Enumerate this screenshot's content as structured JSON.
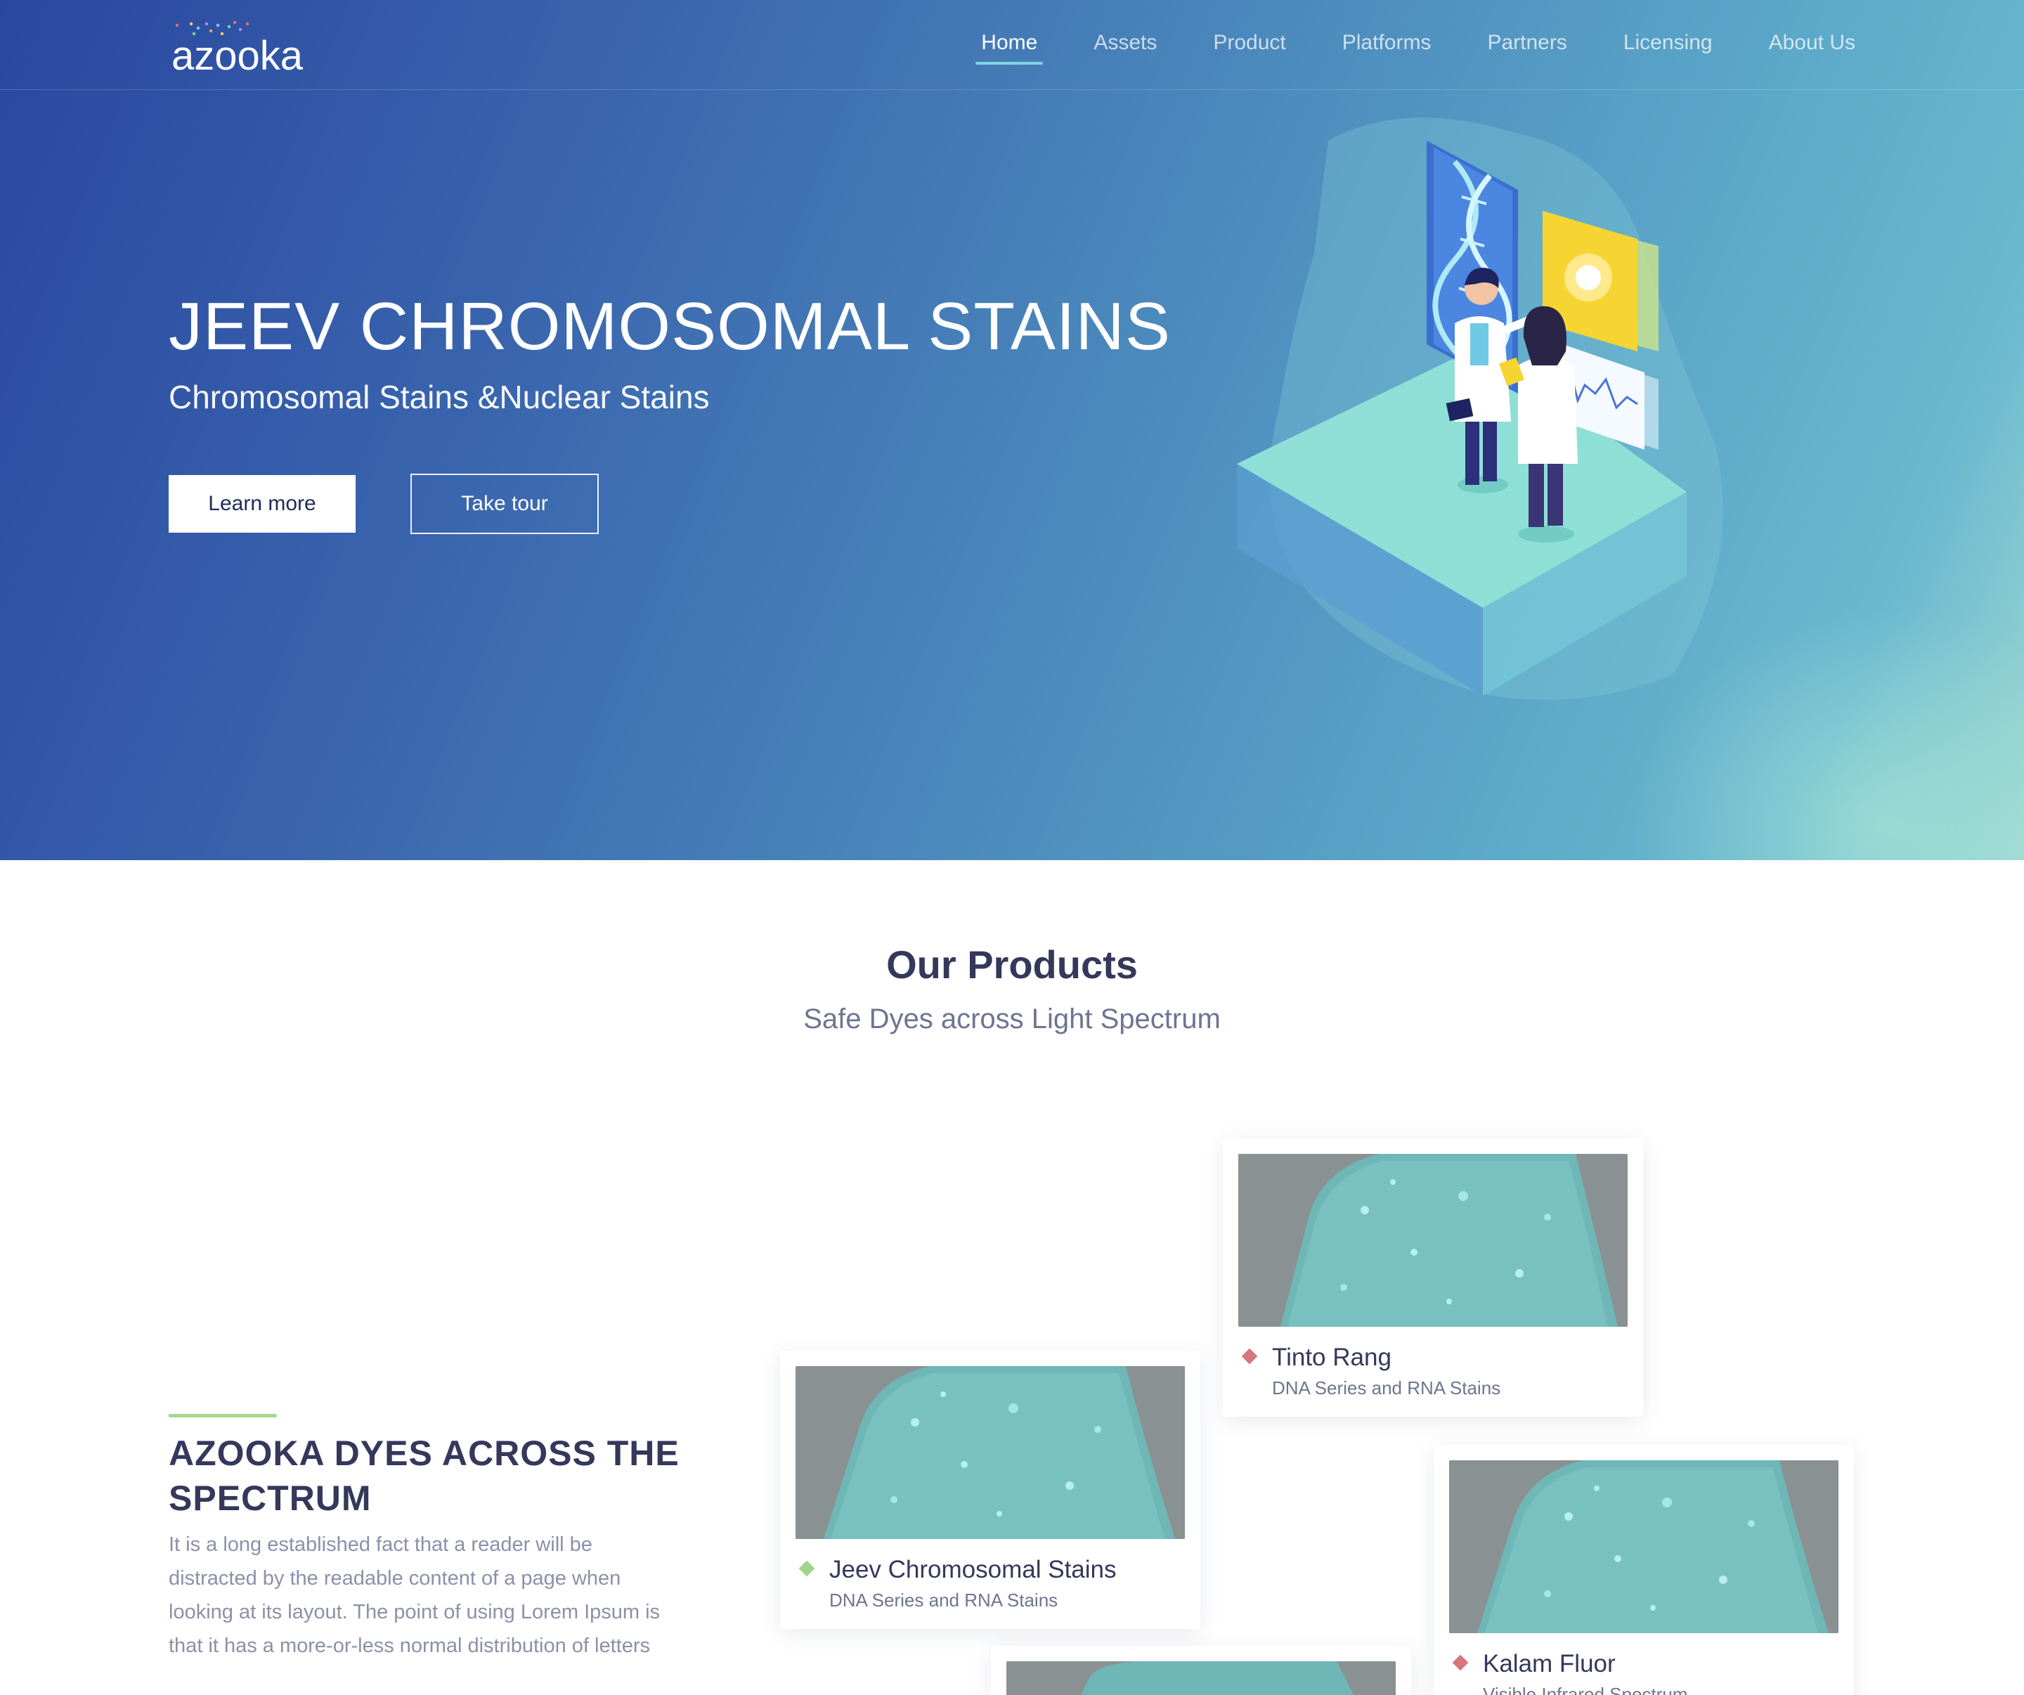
{
  "brand": {
    "logo_text": "azooka"
  },
  "nav": {
    "items": [
      {
        "label": "Home",
        "active": true
      },
      {
        "label": "Assets"
      },
      {
        "label": "Product"
      },
      {
        "label": "Platforms"
      },
      {
        "label": "Partners"
      },
      {
        "label": "Licensing"
      },
      {
        "label": "About Us"
      }
    ]
  },
  "hero": {
    "title": "JEEV CHROMOSOMAL STAINS",
    "subtitle": "Chromosomal Stains &Nuclear Stains",
    "primary_button": "Learn more",
    "secondary_button": "Take tour"
  },
  "products": {
    "title": "Our Products",
    "subtitle": "Safe Dyes across Light Spectrum",
    "feature": {
      "title": "AZOOKA DYES ACROSS THE SPECTRUM",
      "body": "It is a long established fact that a reader will be distracted by the readable content of a page when looking at its layout. The point of using Lorem Ipsum is that it has a more-or-less normal distribution of letters"
    },
    "cards": [
      {
        "name": "Tinto Rang",
        "desc": "DNA Series and RNA Stains",
        "accent": "#d9767b"
      },
      {
        "name": "Jeev Chromosomal Stains",
        "desc": "DNA Series and RNA Stains",
        "accent": "#9fd48a"
      },
      {
        "name": "Kalam Fluor",
        "desc": "Visible Infrared Spectrum",
        "accent": "#d9767b"
      }
    ]
  },
  "colors": {
    "hero_gradient_start": "#2a47a0",
    "hero_gradient_end": "#9fd8d2",
    "text_dark": "#34385a",
    "accent_green": "#a6d88f"
  }
}
